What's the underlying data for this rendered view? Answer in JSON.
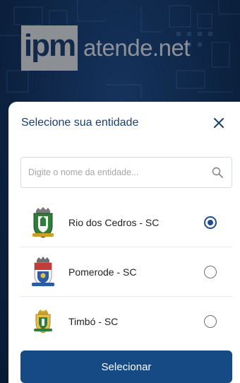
{
  "brand": {
    "logo_mark": "ipm",
    "logo_text": "atende.net"
  },
  "dialog": {
    "title": "Selecione sua entidade",
    "close_icon": "close-icon"
  },
  "search": {
    "placeholder": "Digite o nome da entidade...",
    "value": "",
    "icon": "search-icon"
  },
  "entities": [
    {
      "label": "Rio dos Cedros - SC",
      "selected": true
    },
    {
      "label": "Pomerode - SC",
      "selected": false
    },
    {
      "label": "Timbó - SC",
      "selected": false
    }
  ],
  "actions": {
    "select_label": "Selecionar"
  },
  "colors": {
    "primary": "#164a85",
    "title": "#1a3f6e",
    "background": "#0e2545"
  }
}
